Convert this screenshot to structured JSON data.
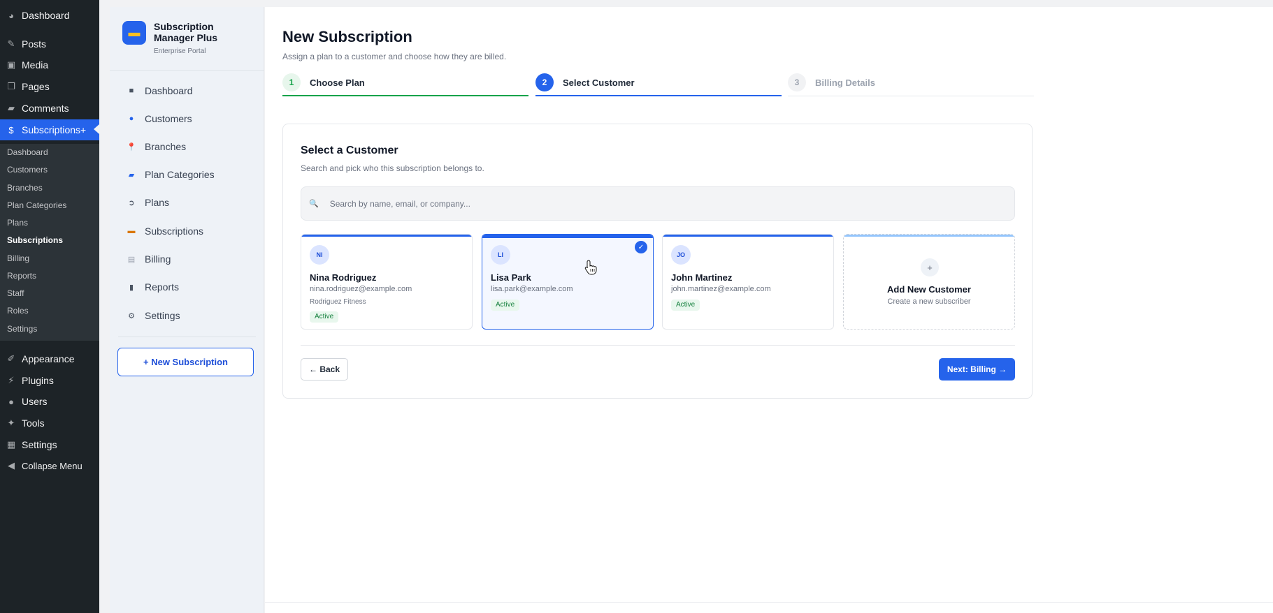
{
  "wp_menu": {
    "items": [
      {
        "label": "Dashboard",
        "icon": "dashboard-icon"
      },
      {
        "label": "Posts",
        "icon": "pin-icon"
      },
      {
        "label": "Media",
        "icon": "media-icon"
      },
      {
        "label": "Pages",
        "icon": "pages-icon"
      },
      {
        "label": "Comments",
        "icon": "comment-icon"
      },
      {
        "label": "Subscriptions+",
        "icon": "dollar-icon"
      },
      {
        "label": "Appearance",
        "icon": "brush-icon"
      },
      {
        "label": "Plugins",
        "icon": "plugin-icon"
      },
      {
        "label": "Users",
        "icon": "user-icon"
      },
      {
        "label": "Tools",
        "icon": "wrench-icon"
      },
      {
        "label": "Settings",
        "icon": "settings-icon"
      },
      {
        "label": "Collapse Menu",
        "icon": "collapse-icon"
      }
    ],
    "submenu": [
      "Dashboard",
      "Customers",
      "Branches",
      "Plan Categories",
      "Plans",
      "Subscriptions",
      "Billing",
      "Reports",
      "Staff",
      "Roles",
      "Settings"
    ],
    "current_submenu": "Subscriptions"
  },
  "plugin": {
    "name": "Subscription Manager Plus",
    "tagline": "Enterprise Portal",
    "nav": [
      {
        "label": "Dashboard",
        "icon": "grid-icon"
      },
      {
        "label": "Customers",
        "icon": "people-icon"
      },
      {
        "label": "Branches",
        "icon": "location-pin-icon"
      },
      {
        "label": "Plan Categories",
        "icon": "folder-icon"
      },
      {
        "label": "Plans",
        "icon": "tag-icon"
      },
      {
        "label": "Subscriptions",
        "icon": "credit-card-icon"
      },
      {
        "label": "Billing",
        "icon": "receipt-icon"
      },
      {
        "label": "Reports",
        "icon": "bar-chart-icon"
      },
      {
        "label": "Settings",
        "icon": "gear-icon"
      }
    ],
    "new_button": "+ New Subscription"
  },
  "page": {
    "title": "New Subscription",
    "subtitle": "Assign a plan to a customer and choose how they are billed."
  },
  "steps": [
    {
      "num": "1",
      "label": "Choose Plan",
      "state": "done"
    },
    {
      "num": "2",
      "label": "Select Customer",
      "state": "current"
    },
    {
      "num": "3",
      "label": "Billing Details",
      "state": "todo"
    }
  ],
  "select_card": {
    "title": "Select a Customer",
    "subtitle": "Search and pick who this subscription belongs to.",
    "search_placeholder": "Search by name, email, or company...",
    "search_value": ""
  },
  "customers": [
    {
      "initials": "NI",
      "name": "Nina Rodriguez",
      "email": "nina.rodriguez@example.com",
      "company": "Rodriguez Fitness",
      "status": "Active",
      "selected": false
    },
    {
      "initials": "LI",
      "name": "Lisa Park",
      "email": "lisa.park@example.com",
      "company": "",
      "status": "Active",
      "selected": true
    },
    {
      "initials": "JO",
      "name": "John Martinez",
      "email": "john.martinez@example.com",
      "company": "",
      "status": "Active",
      "selected": false
    }
  ],
  "add_customer": {
    "title": "Add New Customer",
    "subtitle": "Create a new subscriber"
  },
  "actions": {
    "back": "← Back",
    "next": "Next: Billing →"
  },
  "colors": {
    "accent": "#2563eb",
    "success": "#16a34a",
    "wp_sidebar": "#1d2327"
  }
}
